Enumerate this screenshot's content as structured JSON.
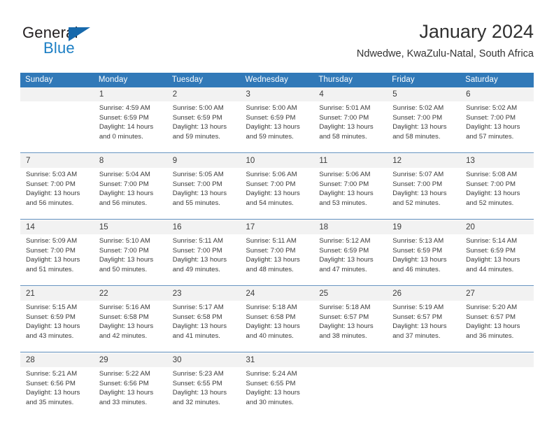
{
  "brand": {
    "name_top": "General",
    "name_bottom": "Blue",
    "accent_color": "#1b7ec4",
    "triangle_color": "#1769ac"
  },
  "header": {
    "title": "January 2024",
    "subtitle": "Ndwedwe, KwaZulu-Natal, South Africa"
  },
  "theme": {
    "header_blue": "#3179b8",
    "daynum_band": "#f2f2f2",
    "week_separator": "#5d8cba"
  },
  "calendar": {
    "weekday_headers": [
      "Sunday",
      "Monday",
      "Tuesday",
      "Wednesday",
      "Thursday",
      "Friday",
      "Saturday"
    ],
    "weeks": [
      [
        {
          "day": ""
        },
        {
          "day": "1",
          "sunrise": "Sunrise: 4:59 AM",
          "sunset": "Sunset: 6:59 PM",
          "daylight_1": "Daylight: 14 hours",
          "daylight_2": "and 0 minutes."
        },
        {
          "day": "2",
          "sunrise": "Sunrise: 5:00 AM",
          "sunset": "Sunset: 6:59 PM",
          "daylight_1": "Daylight: 13 hours",
          "daylight_2": "and 59 minutes."
        },
        {
          "day": "3",
          "sunrise": "Sunrise: 5:00 AM",
          "sunset": "Sunset: 6:59 PM",
          "daylight_1": "Daylight: 13 hours",
          "daylight_2": "and 59 minutes."
        },
        {
          "day": "4",
          "sunrise": "Sunrise: 5:01 AM",
          "sunset": "Sunset: 7:00 PM",
          "daylight_1": "Daylight: 13 hours",
          "daylight_2": "and 58 minutes."
        },
        {
          "day": "5",
          "sunrise": "Sunrise: 5:02 AM",
          "sunset": "Sunset: 7:00 PM",
          "daylight_1": "Daylight: 13 hours",
          "daylight_2": "and 58 minutes."
        },
        {
          "day": "6",
          "sunrise": "Sunrise: 5:02 AM",
          "sunset": "Sunset: 7:00 PM",
          "daylight_1": "Daylight: 13 hours",
          "daylight_2": "and 57 minutes."
        }
      ],
      [
        {
          "day": "7",
          "sunrise": "Sunrise: 5:03 AM",
          "sunset": "Sunset: 7:00 PM",
          "daylight_1": "Daylight: 13 hours",
          "daylight_2": "and 56 minutes."
        },
        {
          "day": "8",
          "sunrise": "Sunrise: 5:04 AM",
          "sunset": "Sunset: 7:00 PM",
          "daylight_1": "Daylight: 13 hours",
          "daylight_2": "and 56 minutes."
        },
        {
          "day": "9",
          "sunrise": "Sunrise: 5:05 AM",
          "sunset": "Sunset: 7:00 PM",
          "daylight_1": "Daylight: 13 hours",
          "daylight_2": "and 55 minutes."
        },
        {
          "day": "10",
          "sunrise": "Sunrise: 5:06 AM",
          "sunset": "Sunset: 7:00 PM",
          "daylight_1": "Daylight: 13 hours",
          "daylight_2": "and 54 minutes."
        },
        {
          "day": "11",
          "sunrise": "Sunrise: 5:06 AM",
          "sunset": "Sunset: 7:00 PM",
          "daylight_1": "Daylight: 13 hours",
          "daylight_2": "and 53 minutes."
        },
        {
          "day": "12",
          "sunrise": "Sunrise: 5:07 AM",
          "sunset": "Sunset: 7:00 PM",
          "daylight_1": "Daylight: 13 hours",
          "daylight_2": "and 52 minutes."
        },
        {
          "day": "13",
          "sunrise": "Sunrise: 5:08 AM",
          "sunset": "Sunset: 7:00 PM",
          "daylight_1": "Daylight: 13 hours",
          "daylight_2": "and 52 minutes."
        }
      ],
      [
        {
          "day": "14",
          "sunrise": "Sunrise: 5:09 AM",
          "sunset": "Sunset: 7:00 PM",
          "daylight_1": "Daylight: 13 hours",
          "daylight_2": "and 51 minutes."
        },
        {
          "day": "15",
          "sunrise": "Sunrise: 5:10 AM",
          "sunset": "Sunset: 7:00 PM",
          "daylight_1": "Daylight: 13 hours",
          "daylight_2": "and 50 minutes."
        },
        {
          "day": "16",
          "sunrise": "Sunrise: 5:11 AM",
          "sunset": "Sunset: 7:00 PM",
          "daylight_1": "Daylight: 13 hours",
          "daylight_2": "and 49 minutes."
        },
        {
          "day": "17",
          "sunrise": "Sunrise: 5:11 AM",
          "sunset": "Sunset: 7:00 PM",
          "daylight_1": "Daylight: 13 hours",
          "daylight_2": "and 48 minutes."
        },
        {
          "day": "18",
          "sunrise": "Sunrise: 5:12 AM",
          "sunset": "Sunset: 6:59 PM",
          "daylight_1": "Daylight: 13 hours",
          "daylight_2": "and 47 minutes."
        },
        {
          "day": "19",
          "sunrise": "Sunrise: 5:13 AM",
          "sunset": "Sunset: 6:59 PM",
          "daylight_1": "Daylight: 13 hours",
          "daylight_2": "and 46 minutes."
        },
        {
          "day": "20",
          "sunrise": "Sunrise: 5:14 AM",
          "sunset": "Sunset: 6:59 PM",
          "daylight_1": "Daylight: 13 hours",
          "daylight_2": "and 44 minutes."
        }
      ],
      [
        {
          "day": "21",
          "sunrise": "Sunrise: 5:15 AM",
          "sunset": "Sunset: 6:59 PM",
          "daylight_1": "Daylight: 13 hours",
          "daylight_2": "and 43 minutes."
        },
        {
          "day": "22",
          "sunrise": "Sunrise: 5:16 AM",
          "sunset": "Sunset: 6:58 PM",
          "daylight_1": "Daylight: 13 hours",
          "daylight_2": "and 42 minutes."
        },
        {
          "day": "23",
          "sunrise": "Sunrise: 5:17 AM",
          "sunset": "Sunset: 6:58 PM",
          "daylight_1": "Daylight: 13 hours",
          "daylight_2": "and 41 minutes."
        },
        {
          "day": "24",
          "sunrise": "Sunrise: 5:18 AM",
          "sunset": "Sunset: 6:58 PM",
          "daylight_1": "Daylight: 13 hours",
          "daylight_2": "and 40 minutes."
        },
        {
          "day": "25",
          "sunrise": "Sunrise: 5:18 AM",
          "sunset": "Sunset: 6:57 PM",
          "daylight_1": "Daylight: 13 hours",
          "daylight_2": "and 38 minutes."
        },
        {
          "day": "26",
          "sunrise": "Sunrise: 5:19 AM",
          "sunset": "Sunset: 6:57 PM",
          "daylight_1": "Daylight: 13 hours",
          "daylight_2": "and 37 minutes."
        },
        {
          "day": "27",
          "sunrise": "Sunrise: 5:20 AM",
          "sunset": "Sunset: 6:57 PM",
          "daylight_1": "Daylight: 13 hours",
          "daylight_2": "and 36 minutes."
        }
      ],
      [
        {
          "day": "28",
          "sunrise": "Sunrise: 5:21 AM",
          "sunset": "Sunset: 6:56 PM",
          "daylight_1": "Daylight: 13 hours",
          "daylight_2": "and 35 minutes."
        },
        {
          "day": "29",
          "sunrise": "Sunrise: 5:22 AM",
          "sunset": "Sunset: 6:56 PM",
          "daylight_1": "Daylight: 13 hours",
          "daylight_2": "and 33 minutes."
        },
        {
          "day": "30",
          "sunrise": "Sunrise: 5:23 AM",
          "sunset": "Sunset: 6:55 PM",
          "daylight_1": "Daylight: 13 hours",
          "daylight_2": "and 32 minutes."
        },
        {
          "day": "31",
          "sunrise": "Sunrise: 5:24 AM",
          "sunset": "Sunset: 6:55 PM",
          "daylight_1": "Daylight: 13 hours",
          "daylight_2": "and 30 minutes."
        },
        {
          "day": ""
        },
        {
          "day": ""
        },
        {
          "day": ""
        }
      ]
    ]
  }
}
